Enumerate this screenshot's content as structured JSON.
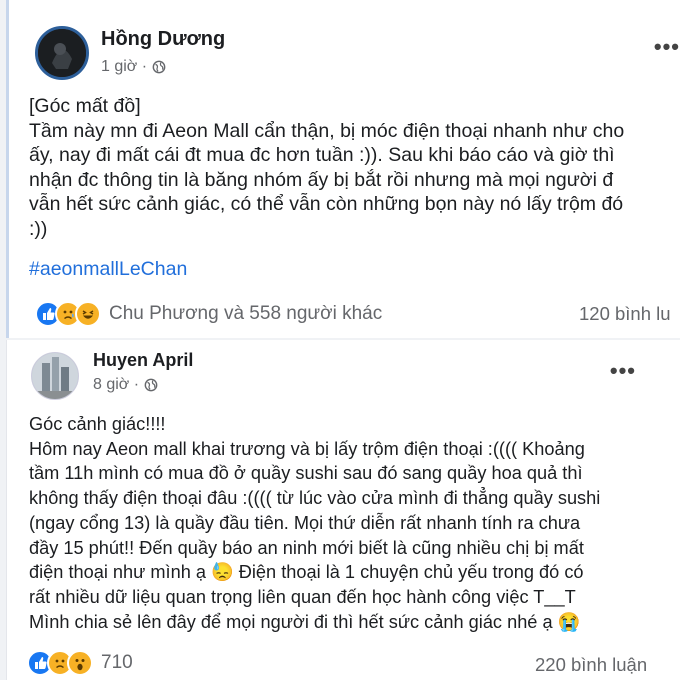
{
  "posts": [
    {
      "author": "Hồng Dương",
      "time": "1 giờ ·",
      "more": "•••",
      "body": "[Góc mất đồ]\nTầm này mn đi Aeon Mall cẩn thận, bị móc điện thoại nhanh như cho\nấy, nay đi mất cái đt mua đc hơn tuần :)). Sau khi báo cáo và giờ thì\nnhận đc thông tin là băng nhóm ấy bị bắt rồi nhưng mà mọi người đ\nvẫn hết sức cảnh giác, có thể vẫn còn những bọn này nó lấy trộm đó\n:))",
      "hashtag": "#aeonmallLeChan",
      "reactions_text": "Chu Phương và 558 người khác",
      "comments": "120 bình lu"
    },
    {
      "author": "Huyen April",
      "time": "8 giờ ·",
      "more": "•••",
      "body": "Góc cảnh giác!!!!\nHôm nay Aeon mall khai trương và bị lấy trộm điện thoại :(((( Khoảng\ntầm 11h mình có mua đồ ở quầy sushi sau đó sang quầy hoa quả thì\nkhông thấy điện thoại đâu :(((( từ lúc vào cửa mình đi thẳng quầy sushi\n(ngay cổng 13) là quầy đầu tiên. Mọi thứ diễn rất nhanh tính ra chưa\nđầy 15 phút!! Đến quầy báo an ninh mới biết là cũng nhiều chị bị mất\nđiện thoại như mình ạ 😓 Điện thoại là 1 chuyện chủ yếu trong đó có\nrất nhiều dữ liệu quan trọng liên quan đến học hành công việc T__T\nMình chia sẻ lên đây để mọi người đi thì hết sức cảnh giác nhé ạ 😭",
      "reactions_text": "710",
      "comments": "220 bình luận"
    }
  ],
  "icons": {
    "globe": "globe-icon",
    "like": "like-reaction-icon",
    "sad": "sad-reaction-icon",
    "haha": "haha-reaction-icon",
    "wow": "wow-reaction-icon"
  },
  "colors": {
    "hashtag": "#216fdb",
    "like": "#1877f2",
    "emoji": "#f7b125"
  }
}
